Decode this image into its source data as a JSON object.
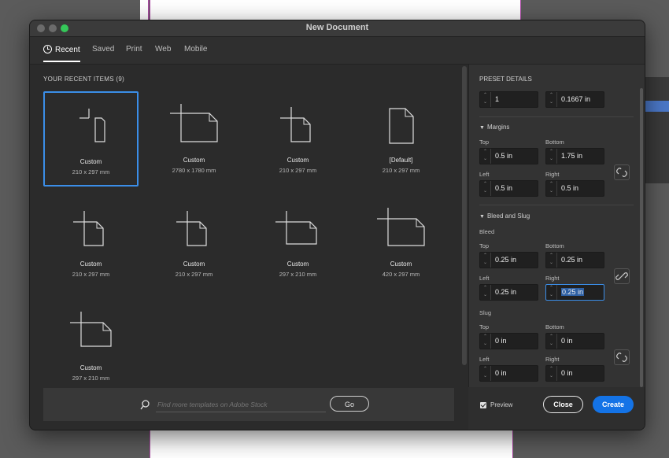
{
  "window": {
    "title": "New Document"
  },
  "tabs": [
    {
      "label": "Recent",
      "icon": "clock-icon"
    },
    {
      "label": "Saved"
    },
    {
      "label": "Print"
    },
    {
      "label": "Web"
    },
    {
      "label": "Mobile"
    }
  ],
  "recent": {
    "heading": "YOUR RECENT ITEMS",
    "count": "(9)",
    "items": [
      {
        "name": "Custom",
        "size": "210 x 297 mm",
        "icon": "portrait-doc-icon"
      },
      {
        "name": "Custom",
        "size": "2780 x 1780 mm",
        "icon": "landscape-doc-icon"
      },
      {
        "name": "Custom",
        "size": "210 x 297 mm",
        "icon": "portrait-doc-icon"
      },
      {
        "name": "[Default]",
        "size": "210 x 297 mm",
        "icon": "portrait-doc-icon"
      },
      {
        "name": "Custom",
        "size": "210 x 297 mm",
        "icon": "portrait-doc-icon"
      },
      {
        "name": "Custom",
        "size": "210 x 297 mm",
        "icon": "portrait-doc-icon"
      },
      {
        "name": "Custom",
        "size": "297 x 210 mm",
        "icon": "landscape-doc-icon"
      },
      {
        "name": "Custom",
        "size": "420 x 297 mm",
        "icon": "landscape-doc-icon"
      },
      {
        "name": "Custom",
        "size": "297 x 210 mm",
        "icon": "landscape-doc-icon"
      }
    ]
  },
  "search": {
    "placeholder": "Find more templates on Adobe Stock",
    "go_label": "Go"
  },
  "preset": {
    "heading": "PRESET DETAILS",
    "top_values": [
      "1",
      "0.1667 in"
    ],
    "margins": {
      "label": "Margins",
      "top_label": "Top",
      "top": "0.5 in",
      "bottom_label": "Bottom",
      "bottom": "1.75 in",
      "left_label": "Left",
      "left": "0.5 in",
      "right_label": "Right",
      "right": "0.5 in"
    },
    "bleed_slug": {
      "label": "Bleed and Slug",
      "bleed_label": "Bleed",
      "bleed": {
        "top_label": "Top",
        "top": "0.25 in",
        "bottom_label": "Bottom",
        "bottom": "0.25 in",
        "left_label": "Left",
        "left": "0.25 in",
        "right_label": "Right",
        "right": "0.25 in"
      },
      "slug_label": "Slug",
      "slug": {
        "top_label": "Top",
        "top": "0 in",
        "bottom_label": "Bottom",
        "bottom": "0 in",
        "left_label": "Left",
        "left": "0 in",
        "right_label": "Right",
        "right": "0 in"
      }
    }
  },
  "footer": {
    "preview_label": "Preview",
    "preview_checked": true,
    "close_label": "Close",
    "create_label": "Create"
  },
  "colors": {
    "accent": "#1473e6",
    "selection": "#3b8ee8",
    "dialog_bg": "#2b2b2b"
  }
}
